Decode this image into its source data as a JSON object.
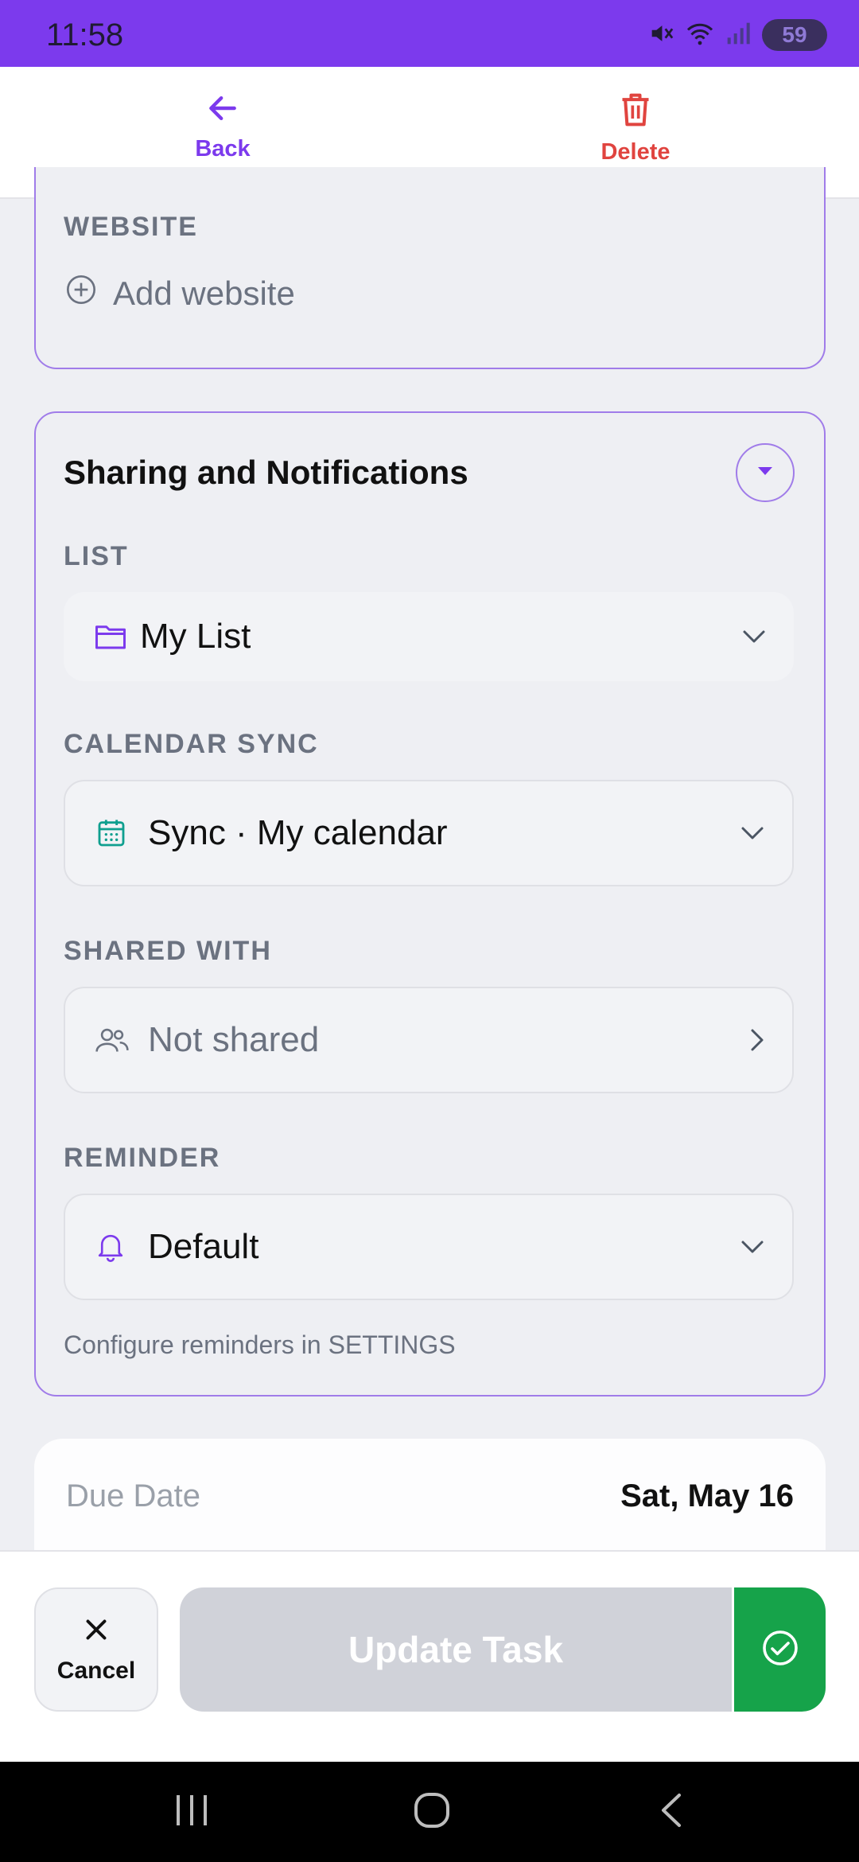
{
  "status_bar": {
    "time": "11:58",
    "battery": "59"
  },
  "header": {
    "back_label": "Back",
    "delete_label": "Delete"
  },
  "website": {
    "label": "WEBSITE",
    "add_label": "Add website"
  },
  "sharing": {
    "title": "Sharing and Notifications",
    "list": {
      "label": "LIST",
      "value": "My List"
    },
    "calendar_sync": {
      "label": "CALENDAR SYNC",
      "value": "Sync · My calendar"
    },
    "shared_with": {
      "label": "SHARED WITH",
      "value": "Not shared"
    },
    "reminder": {
      "label": "REMINDER",
      "value": "Default"
    },
    "hint": "Configure reminders in SETTINGS"
  },
  "due_date": {
    "label": "Due Date",
    "value": "Sat, May 16"
  },
  "footer": {
    "cancel_label": "Cancel",
    "update_label": "Update Task"
  },
  "colors": {
    "accent": "#7c3aed",
    "danger": "#e0443f",
    "success": "#16a34a",
    "calendar_icon": "#0f9f8f"
  },
  "icons": [
    "arrow-left-icon",
    "trash-icon",
    "plus-circle-icon",
    "chevron-down-icon",
    "folder-icon",
    "calendar-icon",
    "users-icon",
    "chevron-right-icon",
    "bell-icon",
    "close-icon",
    "check-circle-icon"
  ]
}
